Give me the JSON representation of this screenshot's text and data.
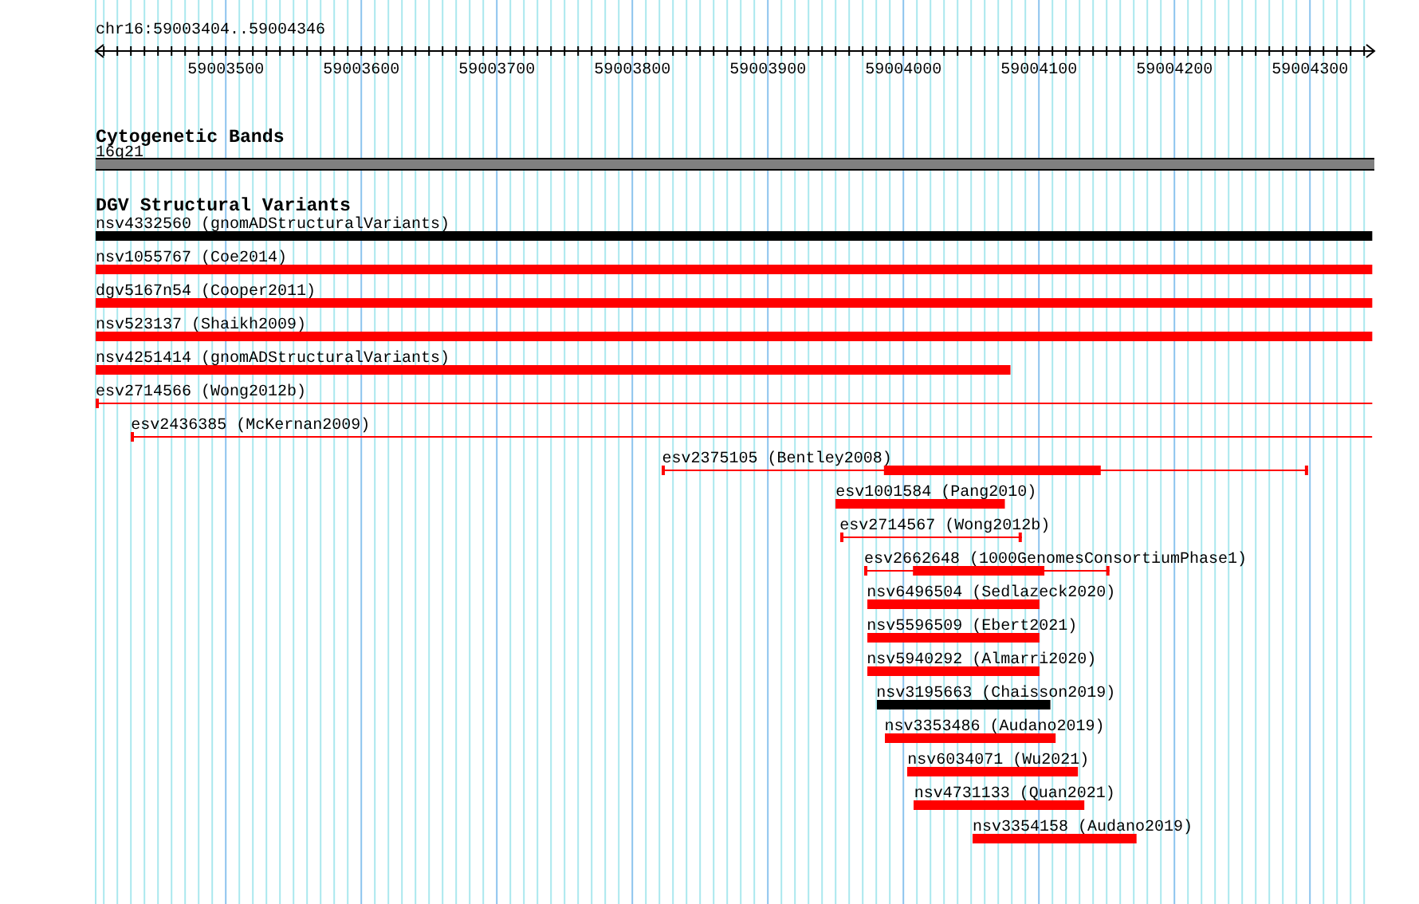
{
  "ruler": {
    "location": "chr16:59003404..59004346",
    "ticks": [
      "59003500",
      "59003600",
      "59003700",
      "59003800",
      "59003900",
      "59004000",
      "59004100",
      "59004200",
      "59004300"
    ]
  },
  "tracks": [
    {
      "title": "Cytogenetic Bands",
      "kind": "bands",
      "features": [
        {
          "label": "16q21",
          "color": "#808080"
        }
      ]
    },
    {
      "title": "DGV Structural Variants",
      "kind": "variants",
      "features": [
        {
          "label": "nsv4332560 (gnomADStructuralVariants)",
          "kind": "bar",
          "color": "#000000"
        },
        {
          "label": "nsv1055767 (Coe2014)",
          "kind": "bar",
          "color": "#ff0000"
        },
        {
          "label": "dgv5167n54 (Cooper2011)",
          "kind": "bar",
          "color": "#ff0000"
        },
        {
          "label": "nsv523137 (Shaikh2009)",
          "kind": "bar",
          "color": "#ff0000"
        },
        {
          "label": "nsv4251414 (gnomADStructuralVariants)",
          "kind": "bar",
          "color": "#ff0000"
        },
        {
          "label": "esv2714566 (Wong2012b)",
          "kind": "span",
          "color": "#ff0000"
        },
        {
          "label": "esv2436385 (McKernan2009)",
          "kind": "span",
          "color": "#ff0000"
        },
        {
          "label": "esv2375105 (Bentley2008)",
          "kind": "span_core",
          "color": "#ff0000"
        },
        {
          "label": "esv1001584 (Pang2010)",
          "kind": "bar",
          "color": "#ff0000"
        },
        {
          "label": "esv2714567 (Wong2012b)",
          "kind": "span",
          "color": "#ff0000"
        },
        {
          "label": "esv2662648 (1000GenomesConsortiumPhase1)",
          "kind": "span_core",
          "color": "#ff0000"
        },
        {
          "label": "nsv6496504 (Sedlazeck2020)",
          "kind": "bar",
          "color": "#ff0000"
        },
        {
          "label": "nsv5596509 (Ebert2021)",
          "kind": "bar",
          "color": "#ff0000"
        },
        {
          "label": "nsv5940292 (Almarri2020)",
          "kind": "bar",
          "color": "#ff0000"
        },
        {
          "label": "nsv3195663 (Chaisson2019)",
          "kind": "bar",
          "color": "#000000"
        },
        {
          "label": "nsv3353486 (Audano2019)",
          "kind": "bar",
          "color": "#ff0000"
        },
        {
          "label": "nsv6034071 (Wu2021)",
          "kind": "bar",
          "color": "#ff0000"
        },
        {
          "label": "nsv4731133 (Quan2021)",
          "kind": "bar",
          "color": "#ff0000"
        },
        {
          "label": "nsv3354158 (Audano2019)",
          "kind": "bar",
          "color": "#ff0000"
        }
      ]
    }
  ]
}
